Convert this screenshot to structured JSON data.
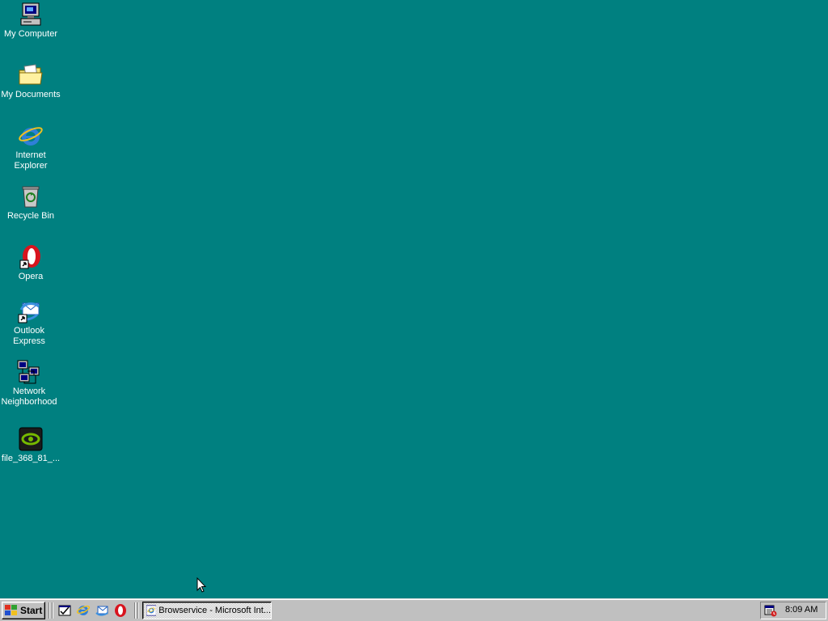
{
  "desktop": {
    "background": "#008080",
    "icons": [
      {
        "label": "My Computer",
        "icon": "my-computer-icon"
      },
      {
        "label": "My Documents",
        "icon": "folder-icon"
      },
      {
        "label": "Internet Explorer",
        "icon": "internet-explorer-icon"
      },
      {
        "label": "Recycle Bin",
        "icon": "recycle-bin-icon"
      },
      {
        "label": "Opera",
        "icon": "opera-icon"
      },
      {
        "label": "Outlook Express",
        "icon": "outlook-express-icon"
      },
      {
        "label": "Network Neighborhood",
        "icon": "network-icon"
      },
      {
        "label": "file_368_81_...",
        "icon": "nvidia-file-icon"
      }
    ]
  },
  "taskbar": {
    "start_label": "Start",
    "quick_launch": [
      "show-desktop-icon",
      "internet-explorer-icon",
      "outlook-express-icon",
      "opera-icon"
    ],
    "task_button_label": "Browservice - Microsoft Int...",
    "clock": "8:09 AM"
  }
}
